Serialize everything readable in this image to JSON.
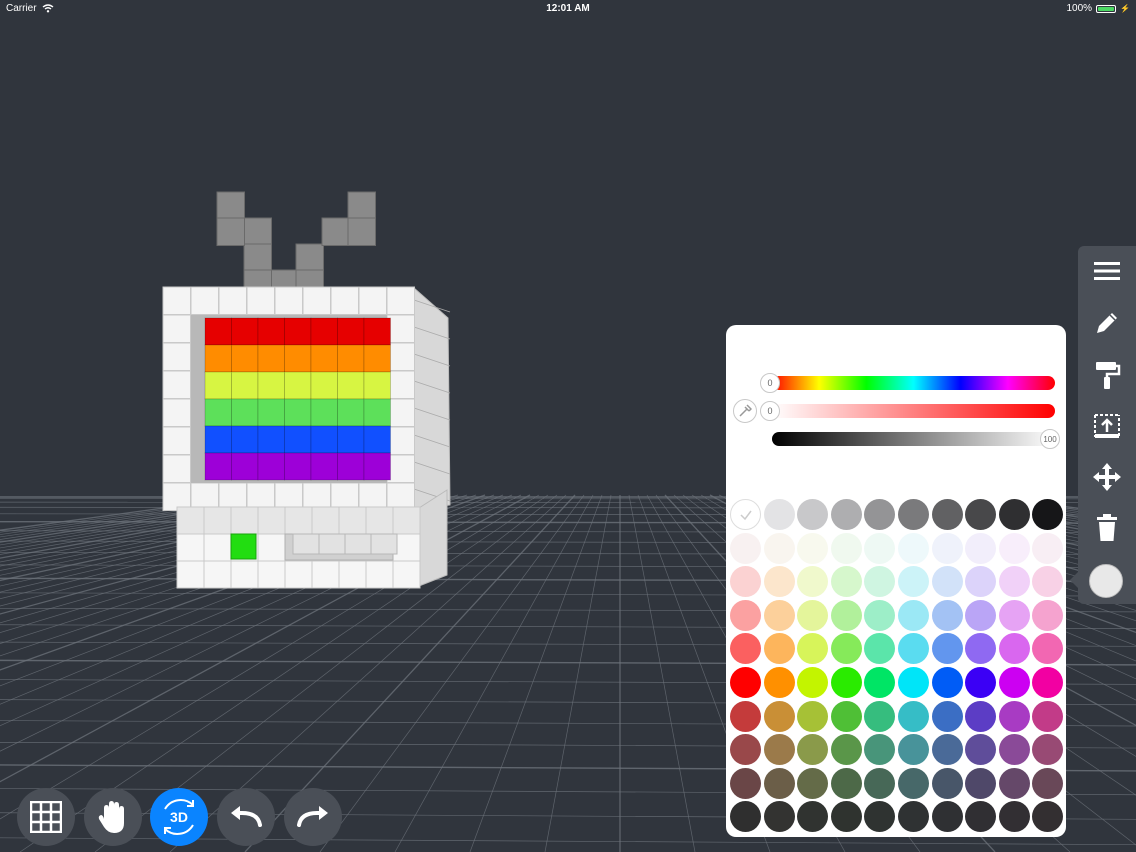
{
  "status_bar": {
    "carrier": "Carrier",
    "time": "12:01 AM",
    "battery": "100%"
  },
  "toolbar": {
    "items": [
      "menu-icon",
      "pencil-icon",
      "paint-roller-icon",
      "extrude-icon",
      "move-icon",
      "trash-icon"
    ],
    "current_color": "#e8e8e8"
  },
  "color_panel": {
    "hue_value": "0",
    "saturation_value": "0",
    "brightness_value": "100",
    "swatch_rows": [
      [
        "none",
        "#e3e3e5",
        "#c8c8ca",
        "#aeaeb0",
        "#949496",
        "#7a7a7c",
        "#616163",
        "#48484a",
        "#2f2f31",
        "#161618"
      ],
      [
        "#f8f1f1",
        "#f9f5ef",
        "#f8f9ee",
        "#f0f9ef",
        "#eef9f4",
        "#eef9fb",
        "#eff2fb",
        "#f2eefb",
        "#f8eefb",
        "#f8eef4"
      ],
      [
        "#fbd2d2",
        "#fce6cc",
        "#f0f9cc",
        "#d6f7cc",
        "#cff5e1",
        "#ccf3f8",
        "#d2e2f9",
        "#dcd3fa",
        "#f1d1f8",
        "#f8d1e6"
      ],
      [
        "#fba1a1",
        "#fcd09b",
        "#e4f59b",
        "#b1f09b",
        "#9deec8",
        "#9be8f5",
        "#a3c2f4",
        "#baa5f6",
        "#e6a3f4",
        "#f5a3cf"
      ],
      [
        "#fb6060",
        "#fdb55c",
        "#d7f45a",
        "#86ea5a",
        "#5be5aa",
        "#5adcf0",
        "#6296ee",
        "#8f69f2",
        "#d967ef",
        "#f267b2"
      ],
      [
        "#ff0000",
        "#ff9000",
        "#c3f400",
        "#2aeb00",
        "#00e565",
        "#00e5f8",
        "#005cf6",
        "#3b00f5",
        "#cc00f2",
        "#f200a2"
      ],
      [
        "#c43b3b",
        "#c98f36",
        "#a6c136",
        "#4fbf36",
        "#36bd7e",
        "#36bdc6",
        "#3b6ec4",
        "#5c3dc5",
        "#a83bc3",
        "#c23b88"
      ],
      [
        "#99484a",
        "#9b7a4a",
        "#8a9a4a",
        "#5a9649",
        "#48957a",
        "#48939a",
        "#4a6a98",
        "#5f4d9a",
        "#8a4a98",
        "#984a74"
      ],
      [
        "#6a4647",
        "#6b5e48",
        "#646b48",
        "#4d6948",
        "#476857",
        "#476869",
        "#485669",
        "#4f4869",
        "#654869",
        "#694858"
      ],
      [
        "#2f2f2f",
        "#333331",
        "#303330",
        "#2f332f",
        "#2f3331",
        "#2f3233",
        "#2f3033",
        "#302f33",
        "#322f33",
        "#332f31"
      ]
    ]
  },
  "bottom_bar": {
    "buttons": [
      "grid-icon",
      "hand-icon",
      "3d-view-icon",
      "undo-icon",
      "redo-icon"
    ],
    "view_label": "3D"
  },
  "scene": {
    "background": "#30353d",
    "grid_color": "#6d737b",
    "screen_row_colors": [
      "#e60000",
      "#ff8c00",
      "#d7f542",
      "#5de05a",
      "#1150ff",
      "#9d00d8"
    ],
    "frame_color": "#f4f4f4",
    "antenna_color": "#8a8a8a",
    "button_color": "#22dd11"
  },
  "colors": {
    "accent": "#0a84ff",
    "toolbar_bg": "#4a4f57"
  }
}
